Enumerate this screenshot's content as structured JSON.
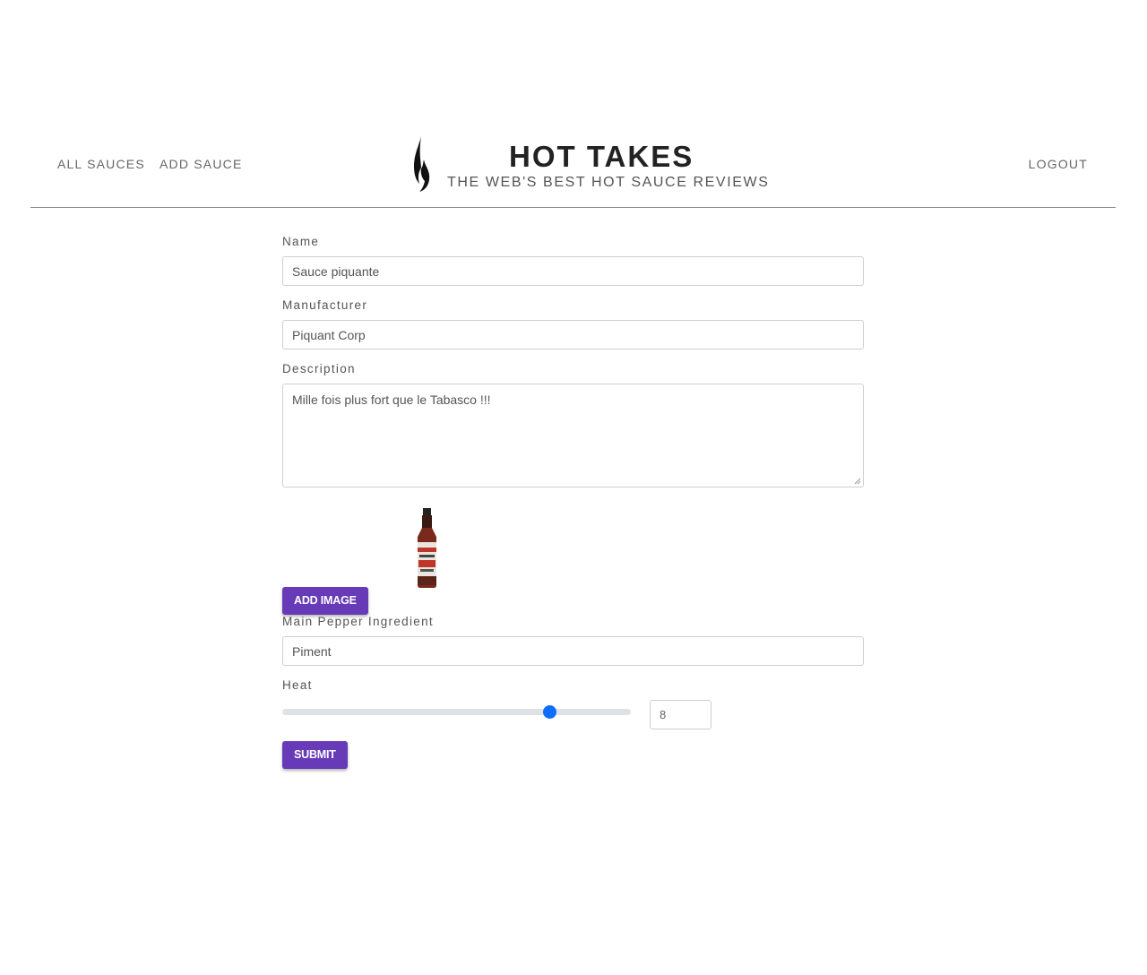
{
  "nav": {
    "all_sauces": "ALL SAUCES",
    "add_sauce": "ADD SAUCE",
    "logout": "LOGOUT"
  },
  "brand": {
    "title": "HOT TAKES",
    "tagline": "THE WEB'S BEST HOT SAUCE REVIEWS",
    "icon": "flame-icon"
  },
  "form": {
    "name": {
      "label": "Name",
      "value": "Sauce piquante"
    },
    "manufacturer": {
      "label": "Manufacturer",
      "value": "Piquant Corp"
    },
    "description": {
      "label": "Description",
      "value": "Mille fois plus fort que le Tabasco !!!"
    },
    "add_image_label": "ADD IMAGE",
    "image_preview": "hot-sauce-bottle-image",
    "main_pepper": {
      "label": "Main Pepper Ingredient",
      "value": "Piment"
    },
    "heat": {
      "label": "Heat",
      "value": "8",
      "min": 1,
      "max": 10,
      "level": 8
    },
    "submit_label": "SUBMIT"
  },
  "colors": {
    "button": "#673ab7",
    "slider_thumb": "#0d6efd",
    "slider_track": "#dee2e6"
  }
}
